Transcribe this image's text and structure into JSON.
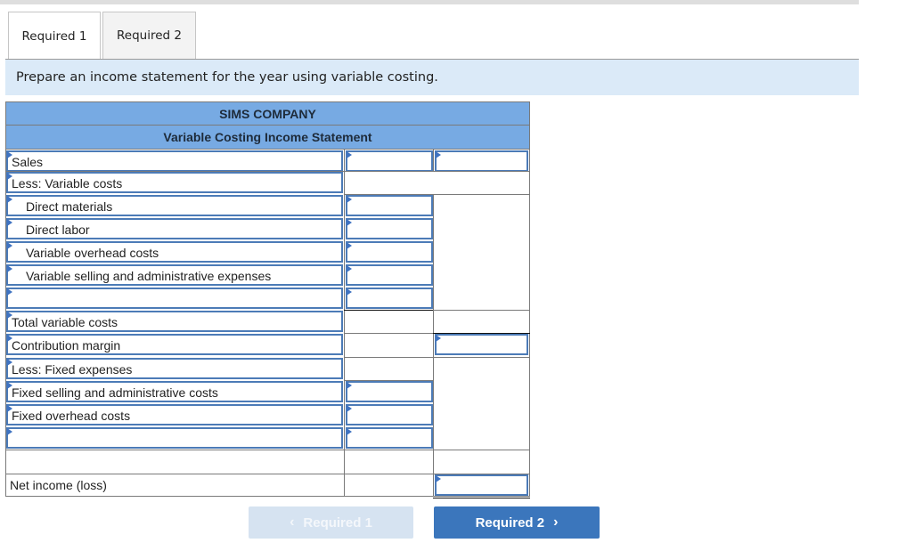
{
  "tabs": [
    {
      "label": "Required 1",
      "active": true
    },
    {
      "label": "Required 2",
      "active": false
    }
  ],
  "instruction": "Prepare an income statement for the year using variable costing.",
  "statement": {
    "company": "SIMS COMPANY",
    "title": "Variable Costing Income Statement",
    "rows": [
      {
        "label": "Sales",
        "indent": false,
        "label_input": true,
        "col1": "",
        "col2": ""
      },
      {
        "label": "Less: Variable costs",
        "indent": false,
        "label_input": true
      },
      {
        "label": "Direct materials",
        "indent": true,
        "label_input": true,
        "col1": ""
      },
      {
        "label": "Direct labor",
        "indent": true,
        "label_input": true,
        "col1": ""
      },
      {
        "label": "Variable overhead costs",
        "indent": true,
        "label_input": true,
        "col1": ""
      },
      {
        "label": "Variable selling and administrative expenses",
        "indent": true,
        "label_input": true,
        "col1": ""
      },
      {
        "label": "",
        "indent": true,
        "label_input": true,
        "col1": ""
      },
      {
        "label": "Total variable costs",
        "indent": false,
        "label_input": true
      },
      {
        "label": "Contribution margin",
        "indent": false,
        "label_input": true,
        "col2": ""
      },
      {
        "label": "Less: Fixed expenses",
        "indent": false,
        "label_input": true
      },
      {
        "label": "Fixed selling and administrative costs",
        "indent": false,
        "label_input": true,
        "col1": ""
      },
      {
        "label": "Fixed overhead costs",
        "indent": false,
        "label_input": true,
        "col1": ""
      },
      {
        "label": "",
        "indent": false,
        "label_input": true,
        "col1": ""
      },
      {
        "label": "",
        "indent": false,
        "label_input": false
      },
      {
        "label": "Net income (loss)",
        "indent": false,
        "label_input": false,
        "col2": ""
      }
    ]
  },
  "nav": {
    "prev_label": "Required 1",
    "next_label": "Required 2",
    "prev_icon": "chevron-left-icon",
    "next_icon": "chevron-right-icon"
  },
  "colors": {
    "header_bg": "#77aae3",
    "instruction_bg": "#dbeaf8",
    "input_border": "#4c7bb7",
    "next_button": "#3b76bc",
    "prev_button_disabled": "#d6e3f1"
  }
}
